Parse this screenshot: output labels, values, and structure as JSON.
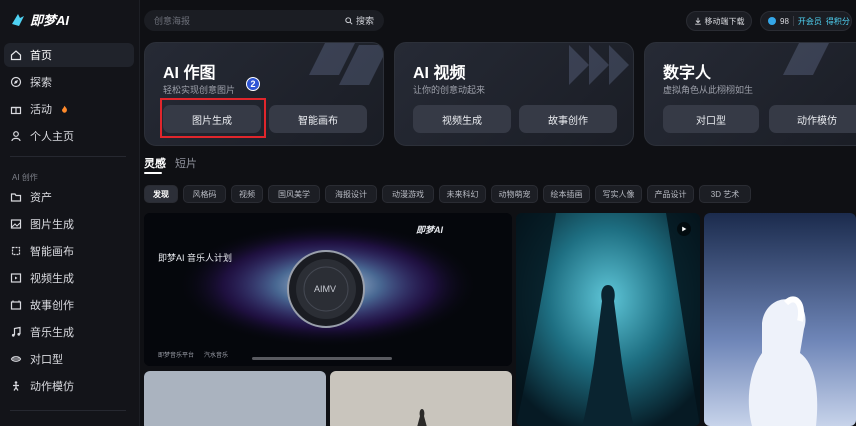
{
  "app": {
    "logo_text": "即梦AI"
  },
  "sidebar": {
    "items": [
      {
        "label": "首页",
        "icon": "home-icon"
      },
      {
        "label": "探索",
        "icon": "compass-icon"
      },
      {
        "label": "活动",
        "icon": "gift-icon"
      },
      {
        "label": "个人主页",
        "icon": "user-icon"
      }
    ],
    "section_label": "AI 创作",
    "creation_items": [
      {
        "label": "资产",
        "icon": "folder-icon"
      },
      {
        "label": "图片生成",
        "icon": "image-icon"
      },
      {
        "label": "智能画布",
        "icon": "canvas-icon"
      },
      {
        "label": "视频生成",
        "icon": "video-icon"
      },
      {
        "label": "故事创作",
        "icon": "story-icon"
      },
      {
        "label": "音乐生成",
        "icon": "music-icon"
      },
      {
        "label": "对口型",
        "icon": "lipsync-icon"
      },
      {
        "label": "动作模仿",
        "icon": "motion-icon"
      }
    ]
  },
  "topbar": {
    "search_placeholder": "创意海报",
    "search_button": "搜索",
    "download_label": "移动端下载",
    "credits": "98",
    "member_label": "开会员",
    "earn_label": "得积分"
  },
  "cards": [
    {
      "title": "AI 作图",
      "subtitle": "轻松实现创意图片",
      "buttons": [
        "图片生成",
        "智能画布"
      ]
    },
    {
      "title": "AI 视频",
      "subtitle": "让你的创意动起来",
      "buttons": [
        "视频生成",
        "故事创作"
      ]
    },
    {
      "title": "数字人",
      "subtitle": "虚拟角色从此栩栩如生",
      "buttons": [
        "对口型",
        "动作模仿"
      ]
    }
  ],
  "annotation": {
    "step_number": "2"
  },
  "feed_tabs": [
    "灵感",
    "短片"
  ],
  "categories": [
    "发现",
    "风格码",
    "视频",
    "国风美学",
    "海报设计",
    "动漫游戏",
    "未来科幻",
    "动物萌宠",
    "绘本插画",
    "写实人像",
    "产品设计",
    "3D 艺术"
  ],
  "banner": {
    "brand_text": "即梦AI",
    "headline": "即梦AI 音乐人计划",
    "disc_text": "AIMV",
    "footer_left": "即梦音乐平台",
    "footer_right": "汽水音乐"
  },
  "colors": {
    "accent": "#4fd2f3",
    "highlight_box": "#e0262c",
    "badge": "#2f55d4"
  }
}
